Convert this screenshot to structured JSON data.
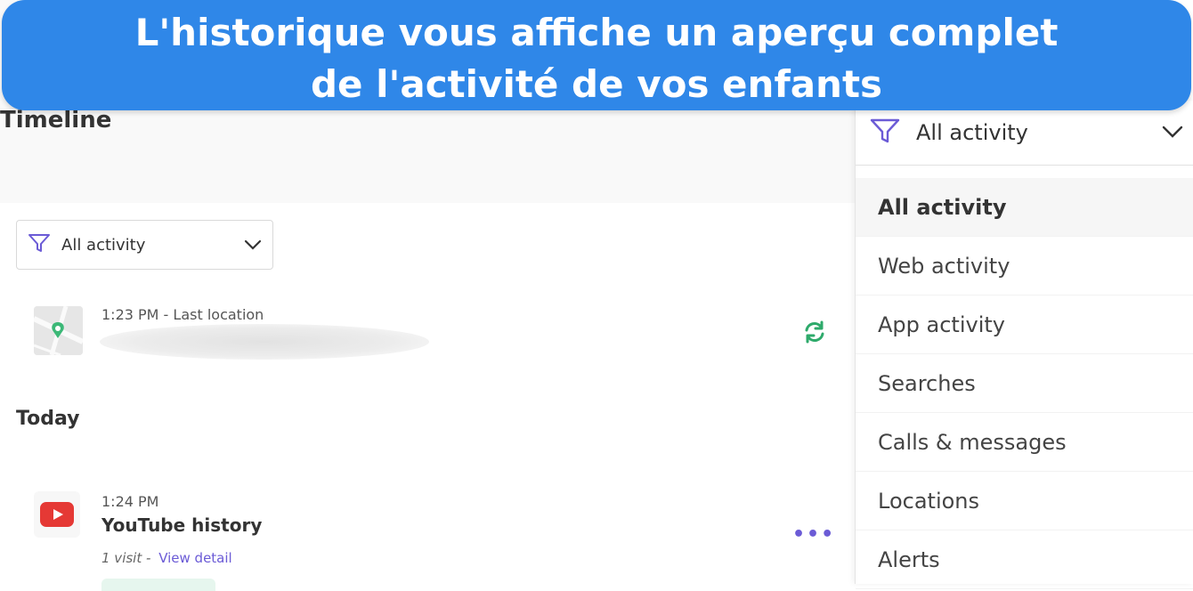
{
  "banner": {
    "line1": "L'historique vous affiche un aperçu complet",
    "line2": "de l'activité de vos enfants"
  },
  "timeline": {
    "title": "Timeline",
    "filter": {
      "selected": "All activity",
      "icon": "filter-icon"
    },
    "location": {
      "time_label": "1:23 PM - Last location",
      "refresh_icon": "refresh-icon"
    },
    "today_heading": "Today",
    "entries": [
      {
        "time": "1:24 PM",
        "title": "YouTube history",
        "visits": "1 visit -",
        "link": "View detail",
        "more_icon": "ellipsis-icon"
      }
    ]
  },
  "dropdown": {
    "selected": "All activity",
    "options": [
      "All activity",
      "Web activity",
      "App activity",
      "Searches",
      "Calls & messages",
      "Locations",
      "Alerts"
    ]
  },
  "colors": {
    "banner": "#2f87e8",
    "accent": "#6b5bd6",
    "refresh": "#2eaa6b",
    "youtube": "#e53935"
  }
}
